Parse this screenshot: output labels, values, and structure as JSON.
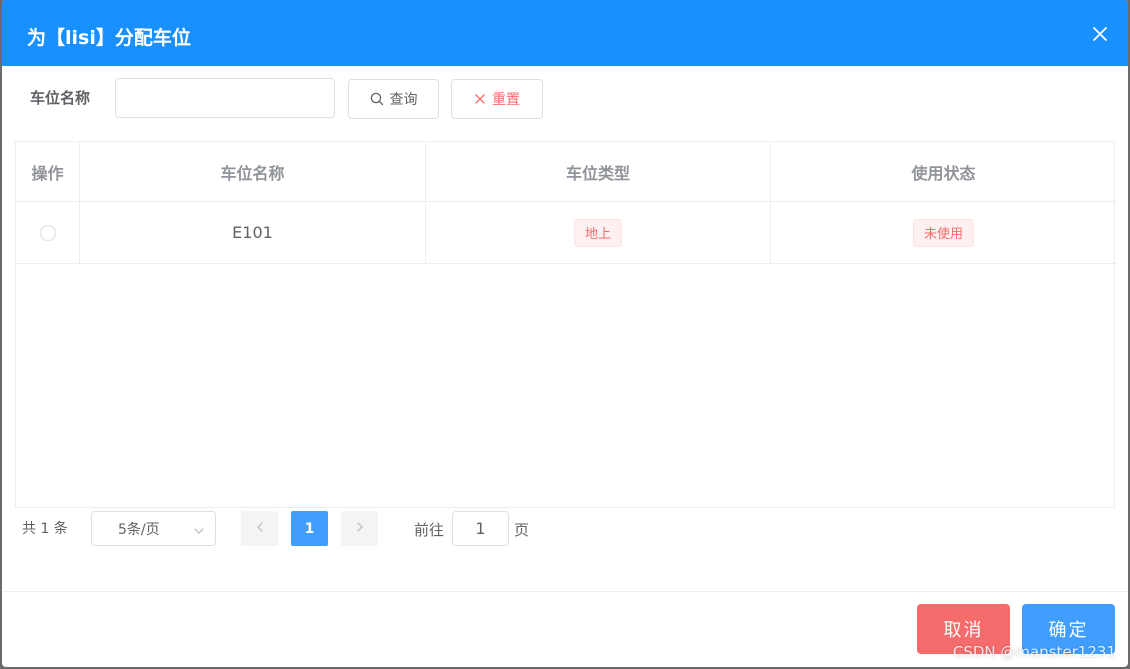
{
  "dialog": {
    "title": "为【lisi】分配车位",
    "close_icon": "close-icon"
  },
  "search": {
    "label": "车位名称",
    "value": "",
    "placeholder": "",
    "query_label": "查询",
    "query_icon": "search-icon",
    "reset_label": "重置",
    "reset_icon": "close-icon"
  },
  "table": {
    "columns": [
      "操作",
      "车位名称",
      "车位类型",
      "使用状态"
    ],
    "rows": [
      {
        "name": "E101",
        "type": "地上",
        "status": "未使用"
      }
    ]
  },
  "pagination": {
    "total": "共 1 条",
    "page_size": "5条/页",
    "current_page": "1",
    "goto_label": "前往",
    "goto_value": "1",
    "goto_unit": "页"
  },
  "footer": {
    "cancel_label": "取消",
    "confirm_label": "确定"
  },
  "watermark": "CSDN @manster1231",
  "colors": {
    "primary": "#1890ff",
    "danger": "#f56c6c",
    "info_blue": "#409eff"
  }
}
